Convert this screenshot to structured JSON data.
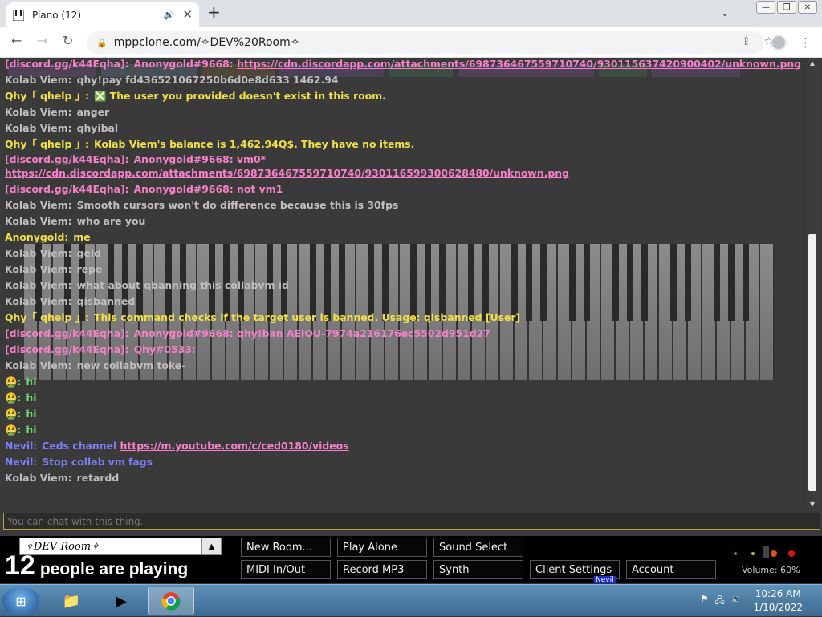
{
  "browser": {
    "tab_title": "Piano (12)",
    "url": "mppclone.com/✧DEV%20Room✧",
    "colors": {
      "tabbar": "#dee1e6",
      "toolbar": "#ffffff",
      "omnibox": "#f1f3f4"
    }
  },
  "chat": {
    "lines": [
      {
        "nick": "[discord.gg/k44Eqha]:",
        "nick_color": "#f580c8",
        "text": "Anonygold#9668:",
        "text_color": "#f580c8",
        "link": "https://cdn.discordapp.com/attachments/698736467559710740/930115637420900402/unknown.png"
      },
      {
        "nick": "Kolab Viem:",
        "nick_color": "#bfbfbf",
        "text": "qhy!pay fd436521067250b6d0e8d633 1462.94",
        "text_color": "#bfbfbf",
        "link": ""
      },
      {
        "nick": "Qhy「 qhelp 」:",
        "nick_color": "#f0e048",
        "text": "❎ The user you provided doesn't exist in this room.",
        "text_color": "#f0e048",
        "link": ""
      },
      {
        "nick": "Kolab Viem:",
        "nick_color": "#bfbfbf",
        "text": "anger",
        "text_color": "#bfbfbf",
        "link": ""
      },
      {
        "nick": "Kolab Viem:",
        "nick_color": "#bfbfbf",
        "text": "qhyibal",
        "text_color": "#bfbfbf",
        "link": ""
      },
      {
        "nick": "Qhy「 qhelp 」:",
        "nick_color": "#f0e048",
        "text": "Kolab Viem's balance is 1,462.94Q$. They have no items.",
        "text_color": "#f0e048",
        "link": ""
      },
      {
        "nick": "[discord.gg/k44Eqha]:",
        "nick_color": "#f580c8",
        "text": "Anonygold#9668: vm0*",
        "text_color": "#f580c8",
        "link": "https://cdn.discordapp.com/attachments/698736467559710740/930116599300628480/unknown.png",
        "multi": true
      },
      {
        "nick": "[discord.gg/k44Eqha]:",
        "nick_color": "#f580c8",
        "text": "Anonygold#9668: not vm1",
        "text_color": "#f580c8",
        "link": ""
      },
      {
        "nick": "Kolab Viem:",
        "nick_color": "#bfbfbf",
        "text": "Smooth cursors won't do difference because this is 30fps",
        "text_color": "#bfbfbf",
        "link": ""
      },
      {
        "nick": "Kolab Viem:",
        "nick_color": "#bfbfbf",
        "text": "who are you",
        "text_color": "#bfbfbf",
        "link": ""
      },
      {
        "nick": "Anonygold:",
        "nick_color": "#f0e048",
        "text": "me",
        "text_color": "#f0e048",
        "link": ""
      },
      {
        "nick": "Kolab Viem:",
        "nick_color": "#bfbfbf",
        "text": "geld",
        "text_color": "#bfbfbf",
        "link": ""
      },
      {
        "nick": "Kolab Viem:",
        "nick_color": "#bfbfbf",
        "text": "repe",
        "text_color": "#bfbfbf",
        "link": ""
      },
      {
        "nick": "Kolab Viem:",
        "nick_color": "#bfbfbf",
        "text": "what about qbanning this collabvm id",
        "text_color": "#bfbfbf",
        "link": ""
      },
      {
        "nick": "Kolab Viem:",
        "nick_color": "#bfbfbf",
        "text": "qisbanned",
        "text_color": "#bfbfbf",
        "link": ""
      },
      {
        "nick": "Qhy「 qhelp 」:",
        "nick_color": "#f0e048",
        "text": "This command checks if the target user is banned. Usage: qisbanned [User]",
        "text_color": "#f0e048",
        "link": ""
      },
      {
        "nick": "[discord.gg/k44Eqha]:",
        "nick_color": "#f580c8",
        "text": "Anonygold#9668: qhy!ban AEIOU-7974a216176ec5502d951d27",
        "text_color": "#f580c8",
        "link": ""
      },
      {
        "nick": "[discord.gg/k44Eqha]:",
        "nick_color": "#f580c8",
        "text": "Qhy#0533:",
        "text_color": "#f580c8",
        "link": ""
      },
      {
        "nick": "Kolab Viem:",
        "nick_color": "#bfbfbf",
        "text": "new collabvm toke-",
        "text_color": "#bfbfbf",
        "link": ""
      },
      {
        "nick": "🤮:",
        "nick_color": "#6ed36e",
        "text": "hi",
        "text_color": "#6ed36e",
        "link": ""
      },
      {
        "nick": "🤮:",
        "nick_color": "#6ed36e",
        "text": "hi",
        "text_color": "#6ed36e",
        "link": ""
      },
      {
        "nick": "🤮:",
        "nick_color": "#6ed36e",
        "text": "hi",
        "text_color": "#6ed36e",
        "link": ""
      },
      {
        "nick": "🤮:",
        "nick_color": "#6ed36e",
        "text": "hi",
        "text_color": "#6ed36e",
        "link": ""
      },
      {
        "nick": "Nevil:",
        "nick_color": "#7b7ef5",
        "text": "Ceds channel",
        "text_color": "#7b7ef5",
        "link": "https://m.youtube.com/c/ced0180/videos"
      },
      {
        "nick": "Nevil:",
        "nick_color": "#7b7ef5",
        "text": "Stop collab vm fags",
        "text_color": "#7b7ef5",
        "link": ""
      },
      {
        "nick": "Kolab Viem:",
        "nick_color": "#bfbfbf",
        "text": "retardd",
        "text_color": "#bfbfbf",
        "link": ""
      }
    ],
    "input_placeholder": "You can chat with this thing."
  },
  "room": {
    "name": "✧DEV Room✧",
    "player_count": "12",
    "player_text": "people are playing"
  },
  "buttons": [
    {
      "label": "New Room...",
      "name": "new-room-button"
    },
    {
      "label": "Play Alone",
      "name": "play-alone-button"
    },
    {
      "label": "Sound Select",
      "name": "sound-select-button"
    },
    {
      "label": "MIDI In/Out",
      "name": "midi-in-out-button"
    },
    {
      "label": "Record MP3",
      "name": "record-mp3-button"
    },
    {
      "label": "Synth",
      "name": "synth-button"
    },
    {
      "label": "Client Settings",
      "name": "client-settings-button"
    },
    {
      "label": "Account",
      "name": "account-button"
    }
  ],
  "volume": {
    "label": "Volume: 60%",
    "value": 0.6
  },
  "cursor_tag": "Nevil",
  "taskbar": {
    "time": "10:26 AM",
    "date": "1/10/2022"
  }
}
